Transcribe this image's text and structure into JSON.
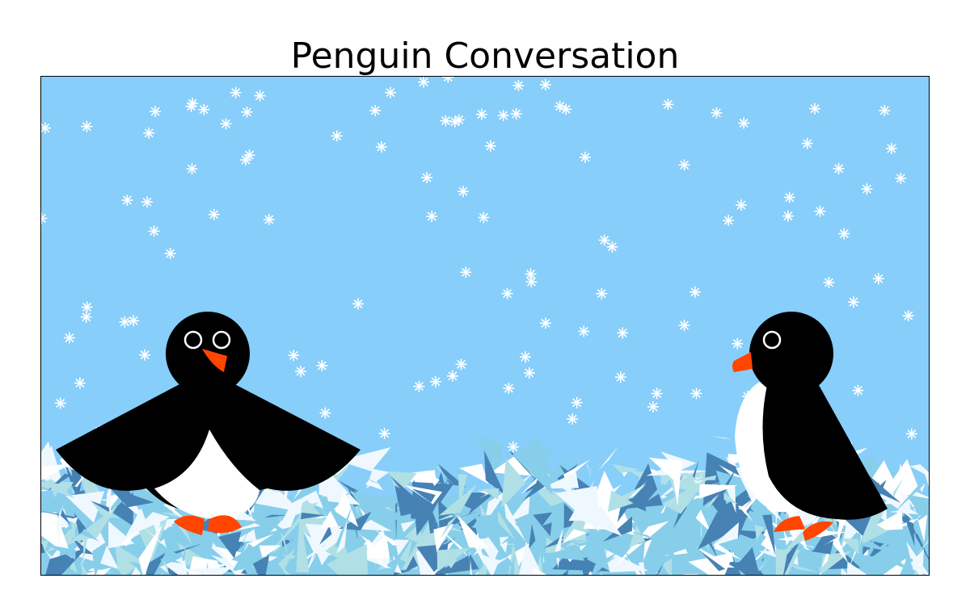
{
  "title": "Penguin Conversation",
  "colors": {
    "sky": "#87CEFA",
    "snowflake": "#FFFFFF",
    "ice": [
      "#4682B4",
      "#87CEEB",
      "#F0F8FF",
      "#FFFFFF",
      "#B0E0E6"
    ],
    "penguin_body": "#000000",
    "penguin_belly": "#FFFFFF",
    "beak_feet": "#FF4500"
  },
  "scene": {
    "elements": [
      "sky-background",
      "falling-snowflakes",
      "ice-field",
      "penguin-left-wings-spread",
      "penguin-right-side-view"
    ]
  }
}
